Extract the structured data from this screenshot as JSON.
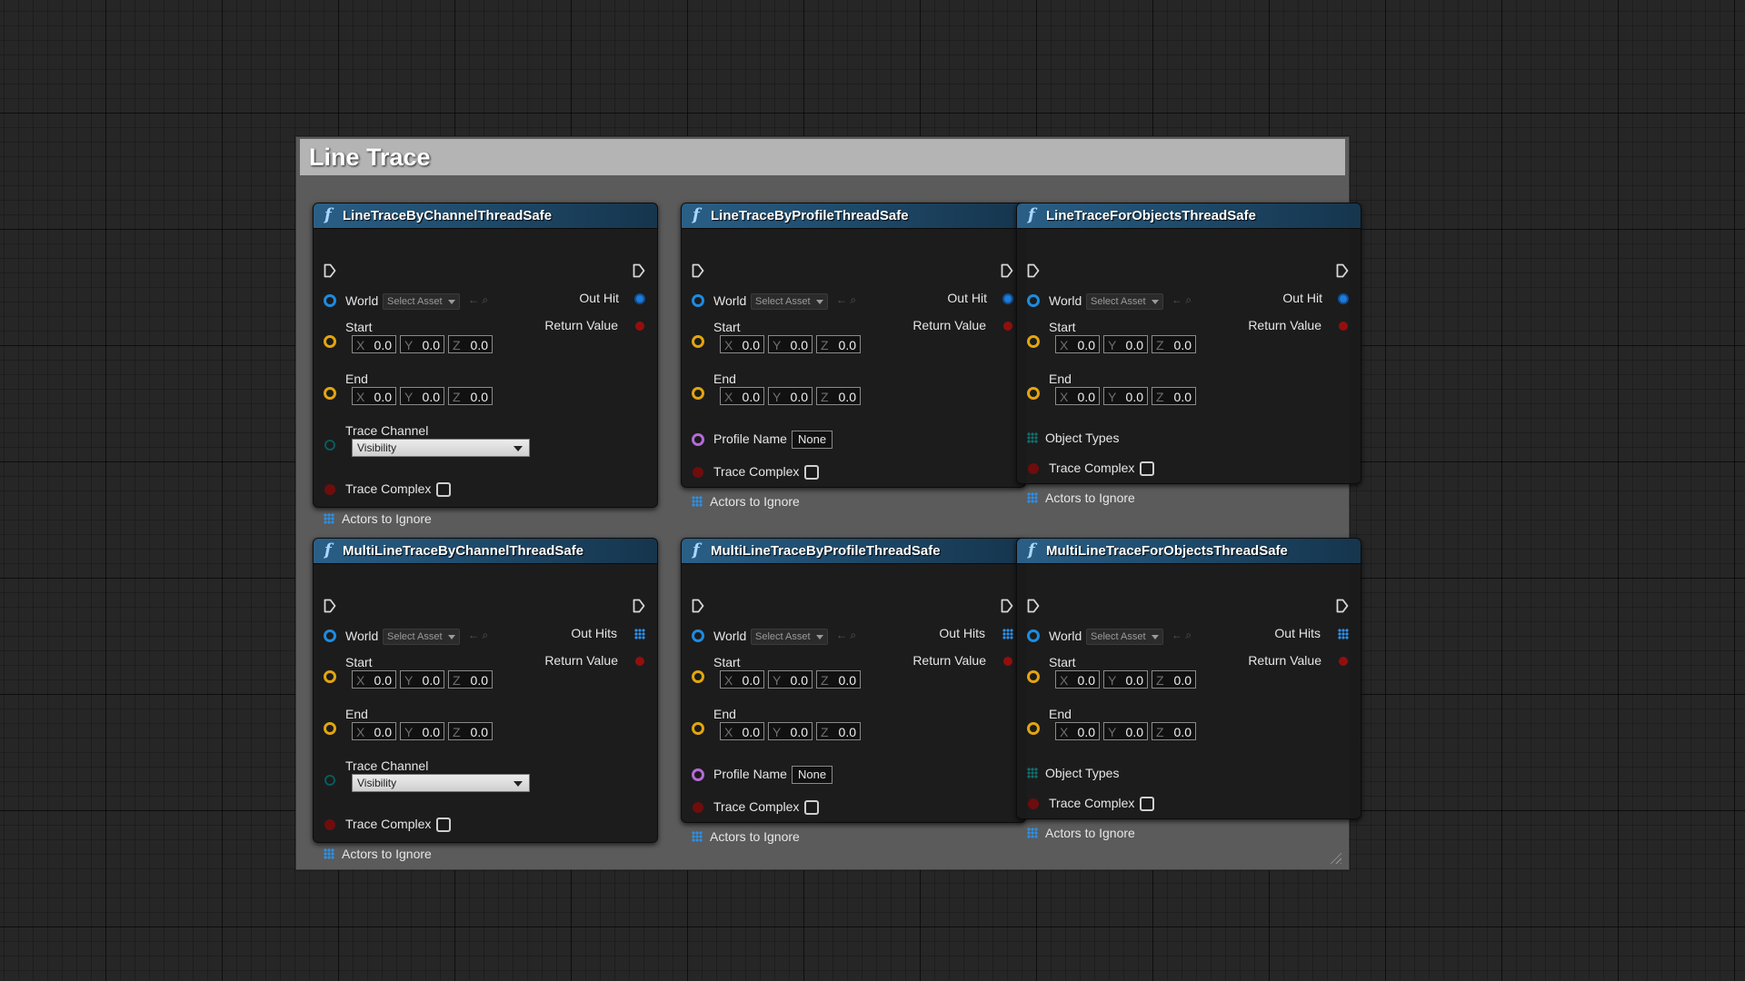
{
  "comment_title": "Line Trace",
  "common": {
    "world_label": "World",
    "select_asset": "Select Asset",
    "start_label": "Start",
    "end_label": "End",
    "axis_x": "X",
    "axis_y": "Y",
    "axis_z": "Z",
    "zero": "0.0",
    "return_value": "Return Value",
    "trace_channel_label": "Trace Channel",
    "trace_channel_value": "Visibility",
    "trace_complex_label": "Trace Complex",
    "actors_to_ignore": "Actors to Ignore",
    "profile_name_label": "Profile Name",
    "profile_name_value": "None",
    "object_types_label": "Object Types",
    "out_hit": "Out Hit",
    "out_hits": "Out Hits"
  },
  "nodes": [
    {
      "title": "LineTraceByChannelThreadSafe",
      "kind": "channel",
      "multi": false
    },
    {
      "title": "LineTraceByProfileThreadSafe",
      "kind": "profile",
      "multi": false
    },
    {
      "title": "LineTraceForObjectsThreadSafe",
      "kind": "objects",
      "multi": false
    },
    {
      "title": "MultiLineTraceByChannelThreadSafe",
      "kind": "channel",
      "multi": true
    },
    {
      "title": "MultiLineTraceByProfileThreadSafe",
      "kind": "profile",
      "multi": true
    },
    {
      "title": "MultiLineTraceForObjectsThreadSafe",
      "kind": "objects",
      "multi": true
    }
  ],
  "colors": {
    "exec": "#d8d8d8",
    "object_pin": "#1e8be0",
    "vector_pin": "#e2a50f",
    "bool_pin": "#930f0f",
    "name_pin": "#b46bd6",
    "header_blue": "#2a5f86"
  },
  "icons": [
    "function-icon",
    "exec-pin-icon",
    "dropdown-arrow-icon",
    "browse-icon",
    "use-selected-icon",
    "array-pin-icon"
  ]
}
